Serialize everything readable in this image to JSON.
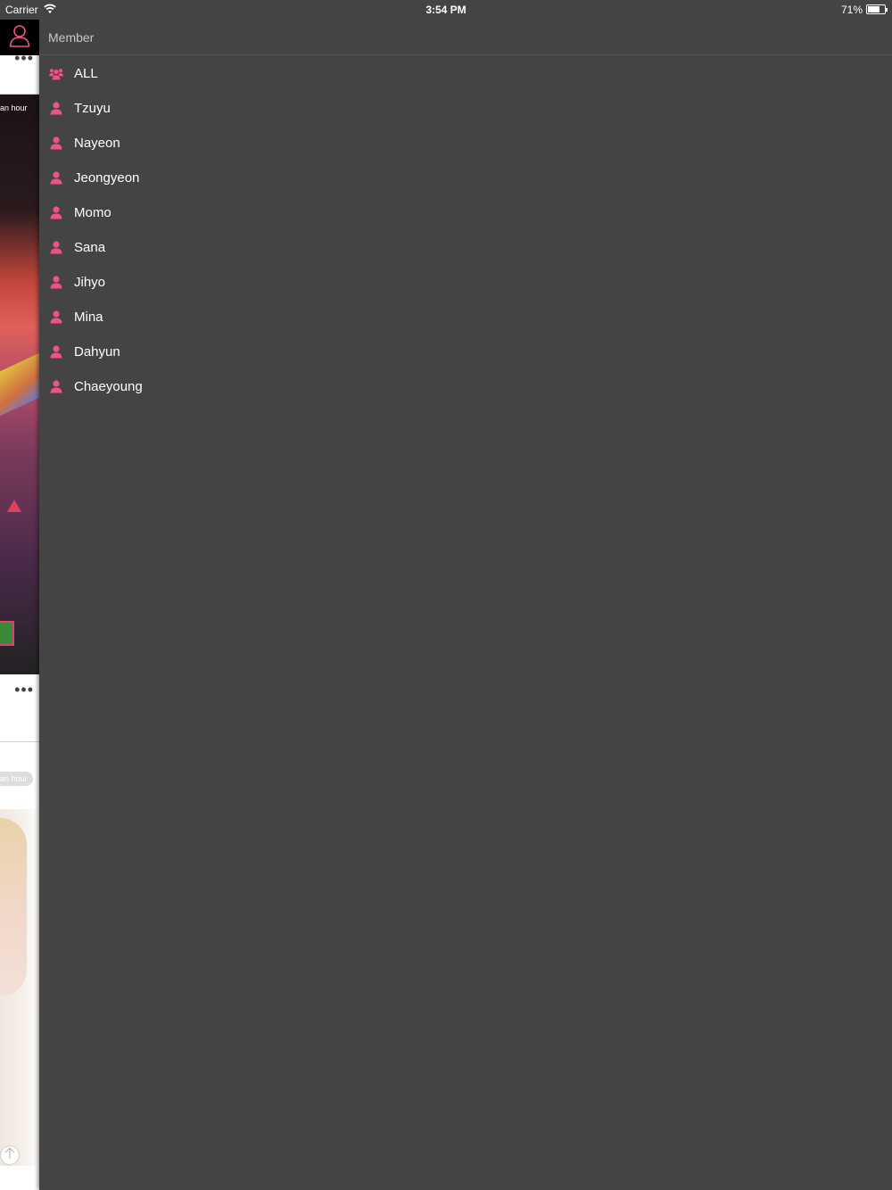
{
  "status_bar": {
    "carrier": "Carrier",
    "time": "3:54 PM",
    "battery_percent": "71%",
    "battery_level": 0.71,
    "wifi_icon": "wifi-icon"
  },
  "background": {
    "time_ago_1": "an hour",
    "time_ago_2": "an hour",
    "more_label": "•••",
    "profile_icon": "person-outline-icon",
    "scroll_top_icon": "arrow-up-icon"
  },
  "drawer": {
    "title": "Member",
    "accent_color": "#f0508c",
    "items": [
      {
        "label": "ALL",
        "icon": "group-icon"
      },
      {
        "label": "Tzuyu",
        "icon": "person-icon"
      },
      {
        "label": "Nayeon",
        "icon": "person-icon"
      },
      {
        "label": "Jeongyeon",
        "icon": "person-icon"
      },
      {
        "label": "Momo",
        "icon": "person-icon"
      },
      {
        "label": "Sana",
        "icon": "person-icon"
      },
      {
        "label": "Jihyo",
        "icon": "person-icon"
      },
      {
        "label": "Mina",
        "icon": "person-icon"
      },
      {
        "label": "Dahyun",
        "icon": "person-icon"
      },
      {
        "label": "Chaeyoung",
        "icon": "person-icon"
      }
    ]
  }
}
